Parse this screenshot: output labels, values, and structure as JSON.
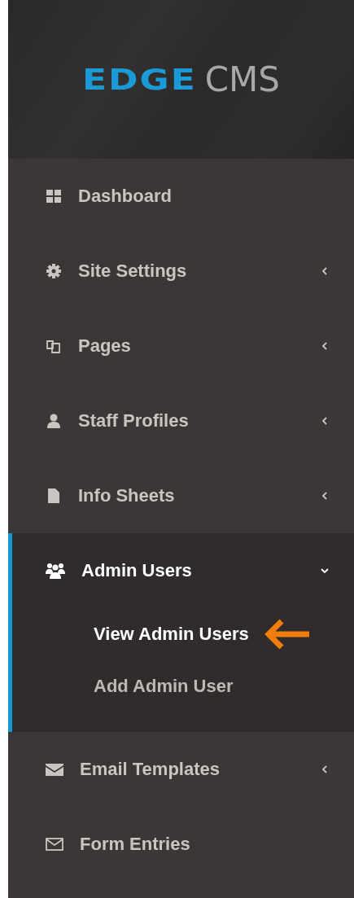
{
  "logo": {
    "brand": "EDGE",
    "product": "CMS"
  },
  "menu": [
    {
      "label": "Dashboard"
    },
    {
      "label": "Site Settings",
      "expanded": false
    },
    {
      "label": "Pages",
      "expanded": false
    },
    {
      "label": "Staff Profiles",
      "expanded": false
    },
    {
      "label": "Info Sheets",
      "expanded": false
    },
    {
      "label": "Admin Users",
      "expanded": true,
      "children": [
        {
          "label": "View Admin Users",
          "selected": true
        },
        {
          "label": "Add Admin User",
          "selected": false
        }
      ]
    },
    {
      "label": "Email Templates",
      "expanded": false
    },
    {
      "label": "Form Entries"
    }
  ]
}
